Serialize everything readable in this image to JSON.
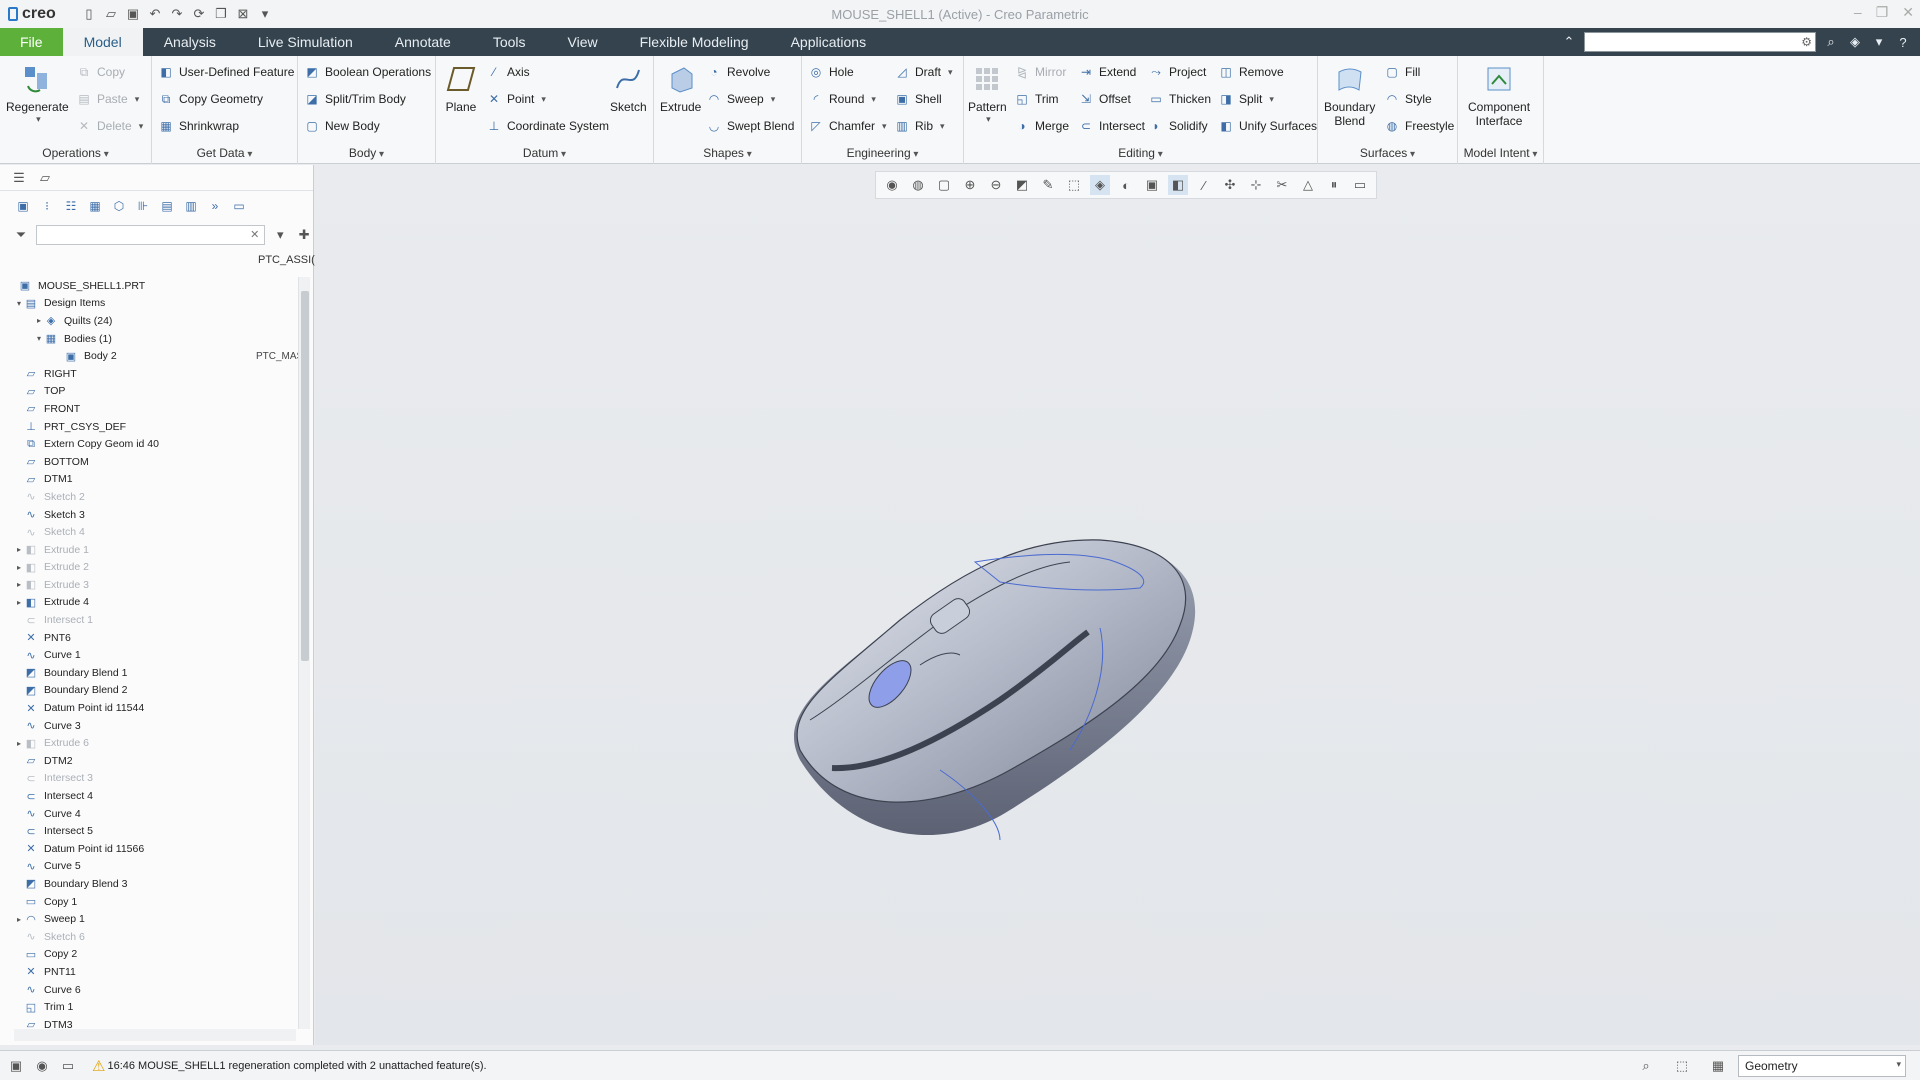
{
  "app": {
    "logo": "creo",
    "title": "MOUSE_SHELL1 (Active) - Creo Parametric"
  },
  "menu": {
    "tabs": [
      "File",
      "Model",
      "Analysis",
      "Live Simulation",
      "Annotate",
      "Tools",
      "View",
      "Flexible Modeling",
      "Applications"
    ],
    "active": "Model",
    "search_value": ""
  },
  "ribbon": {
    "operations": {
      "label": "Operations",
      "regenerate": "Regenerate",
      "copy": "Copy",
      "paste": "Paste",
      "delete": "Delete"
    },
    "get_data": {
      "label": "Get Data",
      "udf": "User-Defined Feature",
      "copy_geometry": "Copy Geometry",
      "shrinkwrap": "Shrinkwrap"
    },
    "body": {
      "label": "Body",
      "boolean": "Boolean Operations",
      "split_trim": "Split/Trim Body",
      "new_body": "New Body"
    },
    "datum": {
      "label": "Datum",
      "plane": "Plane",
      "axis": "Axis",
      "point": "Point",
      "csys": "Coordinate System",
      "sketch": "Sketch"
    },
    "shapes": {
      "label": "Shapes",
      "extrude": "Extrude",
      "revolve": "Revolve",
      "sweep": "Sweep",
      "swept_blend": "Swept Blend"
    },
    "engineering": {
      "label": "Engineering",
      "hole": "Hole",
      "round": "Round",
      "chamfer": "Chamfer",
      "draft": "Draft",
      "shell": "Shell",
      "rib": "Rib"
    },
    "editing": {
      "label": "Editing",
      "pattern": "Pattern",
      "mirror": "Mirror",
      "trim": "Trim",
      "merge": "Merge",
      "extend": "Extend",
      "offset": "Offset",
      "intersect": "Intersect",
      "project": "Project",
      "thicken": "Thicken",
      "solidify": "Solidify",
      "remove": "Remove",
      "split": "Split",
      "unify": "Unify Surfaces"
    },
    "surfaces": {
      "label": "Surfaces",
      "boundary_blend_l1": "Boundary",
      "boundary_blend_l2": "Blend",
      "fill": "Fill",
      "style": "Style",
      "freestyle": "Freestyle"
    },
    "model_intent": {
      "label": "Model Intent",
      "ci_l1": "Component",
      "ci_l2": "Interface"
    }
  },
  "tree": {
    "column_header": "PTC_ASSI(",
    "filter_value": "",
    "items": [
      {
        "label": "MOUSE_SHELL1.PRT",
        "level": 0,
        "icon": "part-icon",
        "exp": "",
        "dim": false,
        "col2": ""
      },
      {
        "label": "Design Items",
        "level": 1,
        "icon": "design-items-icon",
        "exp": "▾",
        "dim": false,
        "col2": ""
      },
      {
        "label": "Quilts (24)",
        "level": 2,
        "icon": "quilt-icon",
        "exp": "▸",
        "dim": false,
        "col2": ""
      },
      {
        "label": "Bodies (1)",
        "level": 2,
        "icon": "bodies-icon",
        "exp": "▾",
        "dim": false,
        "col2": ""
      },
      {
        "label": "Body 2",
        "level": 3,
        "icon": "body-icon",
        "exp": "",
        "dim": false,
        "col2": "PTC_MAS"
      },
      {
        "label": "RIGHT",
        "level": 1,
        "icon": "datum-plane-icon",
        "exp": "",
        "dim": false,
        "col2": ""
      },
      {
        "label": "TOP",
        "level": 1,
        "icon": "datum-plane-icon",
        "exp": "",
        "dim": false,
        "col2": ""
      },
      {
        "label": "FRONT",
        "level": 1,
        "icon": "datum-plane-icon",
        "exp": "",
        "dim": false,
        "col2": ""
      },
      {
        "label": "PRT_CSYS_DEF",
        "level": 1,
        "icon": "csys-icon",
        "exp": "",
        "dim": false,
        "col2": ""
      },
      {
        "label": "Extern Copy Geom id 40",
        "level": 1,
        "icon": "copy-geom-icon",
        "exp": "",
        "dim": false,
        "col2": ""
      },
      {
        "label": "BOTTOM",
        "level": 1,
        "icon": "datum-plane-icon",
        "exp": "",
        "dim": false,
        "col2": ""
      },
      {
        "label": "DTM1",
        "level": 1,
        "icon": "datum-plane-icon",
        "exp": "",
        "dim": false,
        "col2": ""
      },
      {
        "label": "Sketch 2",
        "level": 1,
        "icon": "sketch-icon",
        "exp": "",
        "dim": true,
        "col2": ""
      },
      {
        "label": "Sketch 3",
        "level": 1,
        "icon": "sketch-icon",
        "exp": "",
        "dim": false,
        "col2": ""
      },
      {
        "label": "Sketch 4",
        "level": 1,
        "icon": "sketch-icon",
        "exp": "",
        "dim": true,
        "col2": ""
      },
      {
        "label": "Extrude 1",
        "level": 1,
        "icon": "extrude-icon",
        "exp": "▸",
        "dim": true,
        "col2": ""
      },
      {
        "label": "Extrude 2",
        "level": 1,
        "icon": "extrude-icon",
        "exp": "▸",
        "dim": true,
        "col2": ""
      },
      {
        "label": "Extrude 3",
        "level": 1,
        "icon": "extrude-icon",
        "exp": "▸",
        "dim": true,
        "col2": ""
      },
      {
        "label": "Extrude 4",
        "level": 1,
        "icon": "extrude-icon",
        "exp": "▸",
        "dim": false,
        "col2": ""
      },
      {
        "label": "Intersect 1",
        "level": 1,
        "icon": "intersect-icon",
        "exp": "",
        "dim": true,
        "col2": ""
      },
      {
        "label": "PNT6",
        "level": 1,
        "icon": "datum-point-icon",
        "exp": "",
        "dim": false,
        "col2": ""
      },
      {
        "label": "Curve 1",
        "level": 1,
        "icon": "curve-icon",
        "exp": "",
        "dim": false,
        "col2": ""
      },
      {
        "label": "Boundary Blend 1",
        "level": 1,
        "icon": "boundary-blend-icon",
        "exp": "",
        "dim": false,
        "col2": ""
      },
      {
        "label": "Boundary Blend 2",
        "level": 1,
        "icon": "boundary-blend-icon",
        "exp": "",
        "dim": false,
        "col2": ""
      },
      {
        "label": "Datum Point id 11544",
        "level": 1,
        "icon": "datum-point-icon",
        "exp": "",
        "dim": false,
        "col2": ""
      },
      {
        "label": "Curve 3",
        "level": 1,
        "icon": "curve-icon",
        "exp": "",
        "dim": false,
        "col2": ""
      },
      {
        "label": "Extrude 6",
        "level": 1,
        "icon": "extrude-icon",
        "exp": "▸",
        "dim": true,
        "col2": ""
      },
      {
        "label": "DTM2",
        "level": 1,
        "icon": "datum-plane-icon",
        "exp": "",
        "dim": false,
        "col2": ""
      },
      {
        "label": "Intersect 3",
        "level": 1,
        "icon": "intersect-icon",
        "exp": "",
        "dim": true,
        "col2": ""
      },
      {
        "label": "Intersect 4",
        "level": 1,
        "icon": "intersect-icon",
        "exp": "",
        "dim": false,
        "col2": ""
      },
      {
        "label": "Curve 4",
        "level": 1,
        "icon": "curve-icon",
        "exp": "",
        "dim": false,
        "col2": ""
      },
      {
        "label": "Intersect 5",
        "level": 1,
        "icon": "intersect-icon",
        "exp": "",
        "dim": false,
        "col2": ""
      },
      {
        "label": "Datum Point id 11566",
        "level": 1,
        "icon": "datum-point-icon",
        "exp": "",
        "dim": false,
        "col2": ""
      },
      {
        "label": "Curve 5",
        "level": 1,
        "icon": "curve-icon",
        "exp": "",
        "dim": false,
        "col2": ""
      },
      {
        "label": "Boundary Blend 3",
        "level": 1,
        "icon": "boundary-blend-icon",
        "exp": "",
        "dim": false,
        "col2": ""
      },
      {
        "label": "Copy 1",
        "level": 1,
        "icon": "copy-icon",
        "exp": "",
        "dim": false,
        "col2": ""
      },
      {
        "label": "Sweep 1",
        "level": 1,
        "icon": "sweep-icon",
        "exp": "▸",
        "dim": false,
        "col2": ""
      },
      {
        "label": "Sketch 6",
        "level": 1,
        "icon": "sketch-icon",
        "exp": "",
        "dim": true,
        "col2": ""
      },
      {
        "label": "Copy 2",
        "level": 1,
        "icon": "copy-icon",
        "exp": "",
        "dim": false,
        "col2": ""
      },
      {
        "label": "PNT11",
        "level": 1,
        "icon": "datum-point-icon",
        "exp": "",
        "dim": false,
        "col2": ""
      },
      {
        "label": "Curve 6",
        "level": 1,
        "icon": "curve-icon",
        "exp": "",
        "dim": false,
        "col2": ""
      },
      {
        "label": "Trim 1",
        "level": 1,
        "icon": "trim-icon",
        "exp": "",
        "dim": false,
        "col2": ""
      },
      {
        "label": "DTM3",
        "level": 1,
        "icon": "datum-plane-icon",
        "exp": "",
        "dim": false,
        "col2": ""
      }
    ]
  },
  "status": {
    "message": "16:46 MOUSE_SHELL1 regeneration completed with 2 unattached feature(s).",
    "filter_select": "Geometry"
  },
  "colors": {
    "menubar": "#34434d",
    "file_tab": "#5db13b",
    "accent": "#3d6ea8",
    "model_body": "#aeb6c8",
    "model_button": "#8f9ee8"
  }
}
